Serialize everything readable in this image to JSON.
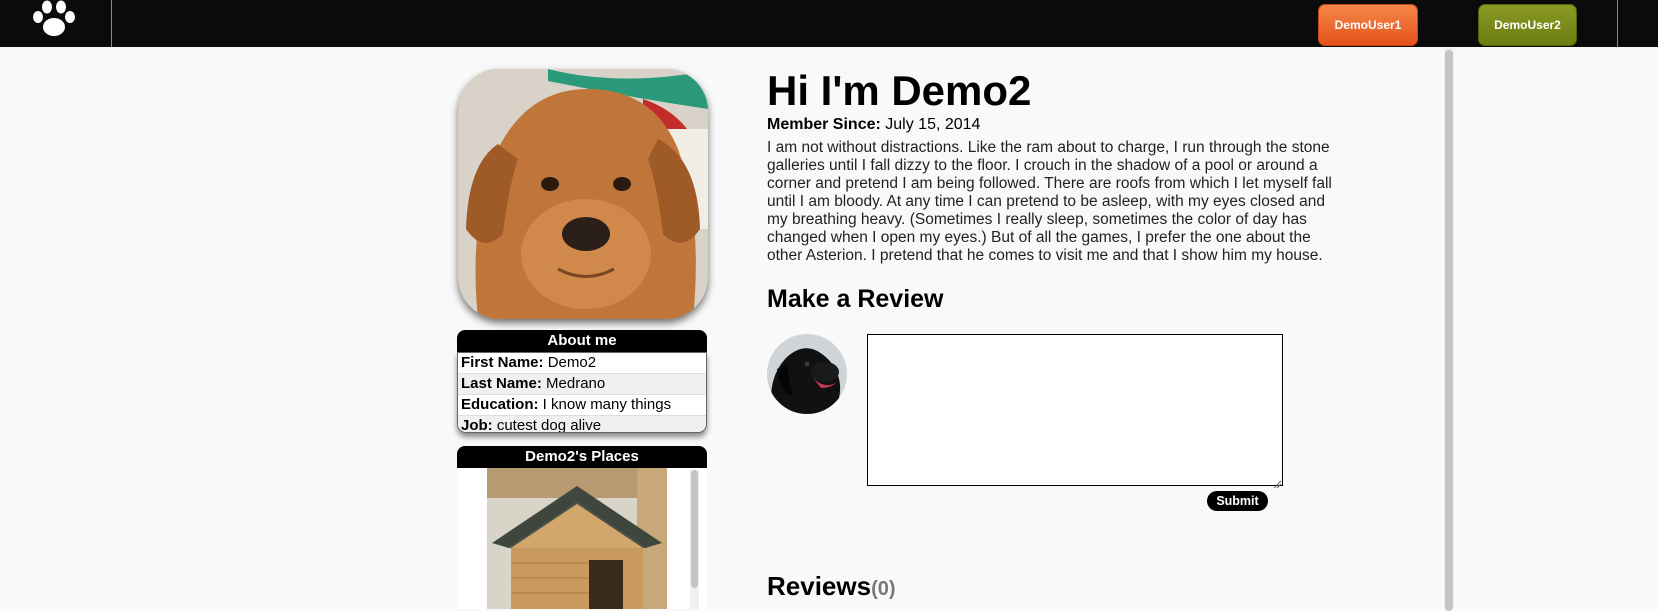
{
  "header": {
    "logo_icon": "paw-icon",
    "users": [
      {
        "label": "DemoUser1",
        "color": "#e4521a"
      },
      {
        "label": "DemoUser2",
        "color": "#6d7c12"
      }
    ]
  },
  "profile": {
    "title": "Hi I'm Demo2",
    "member_since_label": "Member Since:",
    "member_since_value": "July 15, 2014",
    "bio": "I am not without distractions. Like the ram about to charge, I run through the stone galleries until I fall dizzy to the floor. I crouch in the shadow of a pool or around a corner and pretend I am being followed. There are roofs from which I let myself fall until I am bloody. At any time I can pretend to be asleep, with my eyes closed and my breathing heavy. (Sometimes I really sleep, sometimes the color of day has changed when I open my eyes.) But of all the games, I prefer the one about the other Asterion. I pretend that he comes to visit me and that I show him my house."
  },
  "about": {
    "header": "About me",
    "rows": [
      {
        "label": "First Name:",
        "value": "Demo2"
      },
      {
        "label": "Last Name:",
        "value": "Medrano"
      },
      {
        "label": "Education:",
        "value": "I know many things"
      },
      {
        "label": "Job:",
        "value": "cutest dog alive"
      }
    ]
  },
  "places": {
    "header": "Demo2's Places"
  },
  "review_form": {
    "heading": "Make a Review",
    "text_value": "",
    "submit_label": "Submit"
  },
  "reviews": {
    "heading": "Reviews",
    "count": "(0)"
  }
}
